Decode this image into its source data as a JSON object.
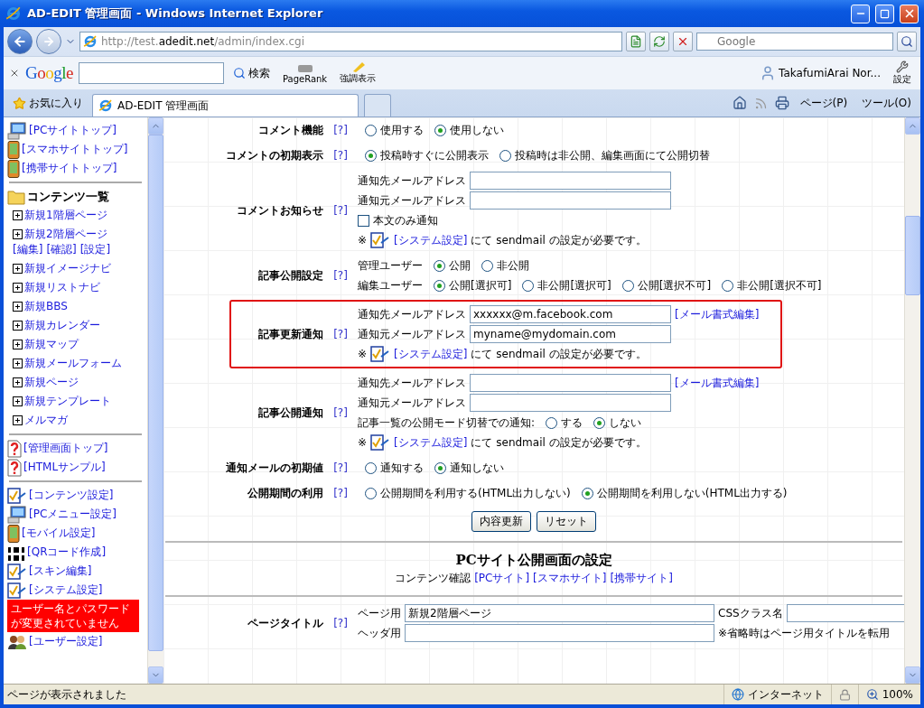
{
  "window": {
    "title": "AD-EDIT 管理画面 - Windows Internet Explorer"
  },
  "address_bar": {
    "url_prefix": "http://test.",
    "url_domain": "adedit.net",
    "url_suffix": "/admin/index.cgi",
    "search_placeholder": "Google"
  },
  "google_toolbar": {
    "logo": "Google",
    "search_button": "検索",
    "buttons": [
      {
        "kind": "pagerank",
        "label": "PageRank"
      },
      {
        "kind": "highlight",
        "label": "強調表示"
      }
    ],
    "user": "TakafumiArai Nor...",
    "settings": "設定"
  },
  "tab_bar": {
    "favorites": "お気に入り",
    "tabs": [
      {
        "label": "AD-EDIT 管理画面",
        "selected": true
      }
    ],
    "menus": [
      "ページ(P)",
      "ツール(O)"
    ]
  },
  "sidebar": {
    "site_links": [
      {
        "kind": "pc",
        "label": "[PCサイトトップ]"
      },
      {
        "kind": "phone",
        "label": "[スマホサイトトップ]"
      },
      {
        "kind": "phone",
        "label": "[携帯サイトトップ]"
      }
    ],
    "contents_title": "コンテンツ一覧",
    "contents": [
      {
        "label": "新規1階層ページ"
      },
      {
        "label": "新規2階層ページ",
        "actions": [
          "[編集]",
          "[確認]",
          "[設定]"
        ]
      },
      {
        "label": "新規イメージナビ"
      },
      {
        "label": "新規リストナビ"
      },
      {
        "label": "新規BBS"
      },
      {
        "label": "新規カレンダー"
      },
      {
        "label": "新規マップ"
      },
      {
        "label": "新規メールフォーム"
      },
      {
        "label": "新規ページ"
      },
      {
        "label": "新規テンプレート"
      },
      {
        "label": "メルマガ"
      }
    ],
    "help_links": [
      {
        "kind": "help",
        "label": "[管理画面トップ]"
      },
      {
        "kind": "help",
        "label": "[HTMLサンプル]"
      }
    ],
    "settings_links": [
      {
        "kind": "check",
        "label": "[コンテンツ設定]"
      },
      {
        "kind": "pc",
        "label": "[PCメニュー設定]"
      },
      {
        "kind": "phone",
        "label": "[モバイル設定]"
      },
      {
        "kind": "qr",
        "label": "[QRコード作成]"
      },
      {
        "kind": "check",
        "label": "[スキン編集]"
      },
      {
        "kind": "check",
        "label": "[システム設定]"
      }
    ],
    "warning": "ユーザー名とパスワードが変更されていません",
    "extra_links": [
      {
        "kind": "users",
        "label": "[ユーザー設定]"
      }
    ]
  },
  "main": {
    "rows": [
      {
        "label": "コメント機能",
        "help": "[?]",
        "highlighted": false,
        "lines": [
          {
            "kind": "radio",
            "options": [
              {
                "label": "使用する",
                "selected": false
              },
              {
                "label": "使用しない",
                "selected": true
              }
            ]
          }
        ]
      },
      {
        "label": "コメントの初期表示",
        "help": "[?]",
        "highlighted": false,
        "lines": [
          {
            "kind": "radio",
            "options": [
              {
                "label": "投稿時すぐに公開表示",
                "selected": true
              },
              {
                "label": "投稿時は非公開、編集画面にて公開切替",
                "selected": false
              }
            ]
          }
        ]
      },
      {
        "label": "コメントお知らせ",
        "help": "[?]",
        "highlighted": false,
        "lines": [
          {
            "kind": "field",
            "label": "通知先メールアドレス"
          },
          {
            "kind": "field",
            "label": "通知元メールアドレス"
          },
          {
            "kind": "checkbox",
            "label": "本文のみ通知",
            "checked": false
          },
          {
            "kind": "note",
            "mark": "※",
            "link": "[システム設定]",
            "text": "にて sendmail の設定が必要です。"
          }
        ]
      },
      {
        "label": "記事公開設定",
        "help": "[?]",
        "highlighted": false,
        "lines": [
          {
            "kind": "radio",
            "label": "管理ユーザー",
            "options": [
              {
                "label": "公開",
                "selected": true
              },
              {
                "label": "非公開",
                "selected": false
              }
            ]
          },
          {
            "kind": "radio",
            "label": "編集ユーザー",
            "options": [
              {
                "label": "公開[選択可]",
                "selected": true
              },
              {
                "label": "非公開[選択可]",
                "selected": false
              },
              {
                "label": "公開[選択不可]",
                "selected": false
              },
              {
                "label": "非公開[選択不可]",
                "selected": false
              }
            ]
          }
        ]
      },
      {
        "label": "記事更新通知",
        "help": "[?]",
        "highlighted": true,
        "lines": [
          {
            "kind": "field",
            "label": "通知先メールアドレス",
            "value": "xxxxxx@m.facebook.com",
            "link": "[メール書式編集]"
          },
          {
            "kind": "field",
            "label": "通知元メールアドレス",
            "value": "myname@mydomain.com"
          },
          {
            "kind": "note",
            "mark": "※",
            "link": "[システム設定]",
            "text": "にて sendmail の設定が必要です。"
          }
        ]
      },
      {
        "label": "記事公開通知",
        "help": "[?]",
        "highlighted": false,
        "lines": [
          {
            "kind": "field",
            "label": "通知先メールアドレス",
            "link": "[メール書式編集]"
          },
          {
            "kind": "field",
            "label": "通知元メールアドレス"
          },
          {
            "kind": "radio",
            "label": "記事一覧の公開モード切替での通知:",
            "options": [
              {
                "label": "する",
                "selected": false
              },
              {
                "label": "しない",
                "selected": true
              }
            ]
          },
          {
            "kind": "note",
            "mark": "※",
            "link": "[システム設定]",
            "text": "にて sendmail の設定が必要です。"
          }
        ]
      },
      {
        "label": "通知メールの初期値",
        "help": "[?]",
        "highlighted": false,
        "lines": [
          {
            "kind": "radio",
            "options": [
              {
                "label": "通知する",
                "selected": false
              },
              {
                "label": "通知しない",
                "selected": true
              }
            ]
          }
        ]
      },
      {
        "label": "公開期間の利用",
        "help": "[?]",
        "highlighted": false,
        "lines": [
          {
            "kind": "radio",
            "options": [
              {
                "label": "公開期間を利用する(HTML出力しない)",
                "selected": false
              },
              {
                "label": "公開期間を利用しない(HTML出力する)",
                "selected": true
              }
            ]
          }
        ]
      }
    ],
    "buttons": [
      "内容更新",
      "リセット"
    ],
    "section": {
      "title": "PCサイト公開画面の設定",
      "caption": "コンテンツ確認",
      "links": [
        "[PCサイト]",
        "[スマホサイト]",
        "[携帯サイト]"
      ]
    },
    "settings_rows": [
      {
        "label": "ページタイトル",
        "help": "[?]",
        "highlighted": false,
        "lines": [
          {
            "kind": "field",
            "label": "ページ用",
            "value": "新規2階層ページ",
            "side_label": "CSSクラス名"
          },
          {
            "kind": "field",
            "label": "ヘッダ用",
            "note": "※省略時はページ用タイトルを転用"
          }
        ]
      }
    ]
  },
  "status_bar": {
    "text": "ページが表示されました",
    "zone": "インターネット",
    "zoom": "100%"
  }
}
